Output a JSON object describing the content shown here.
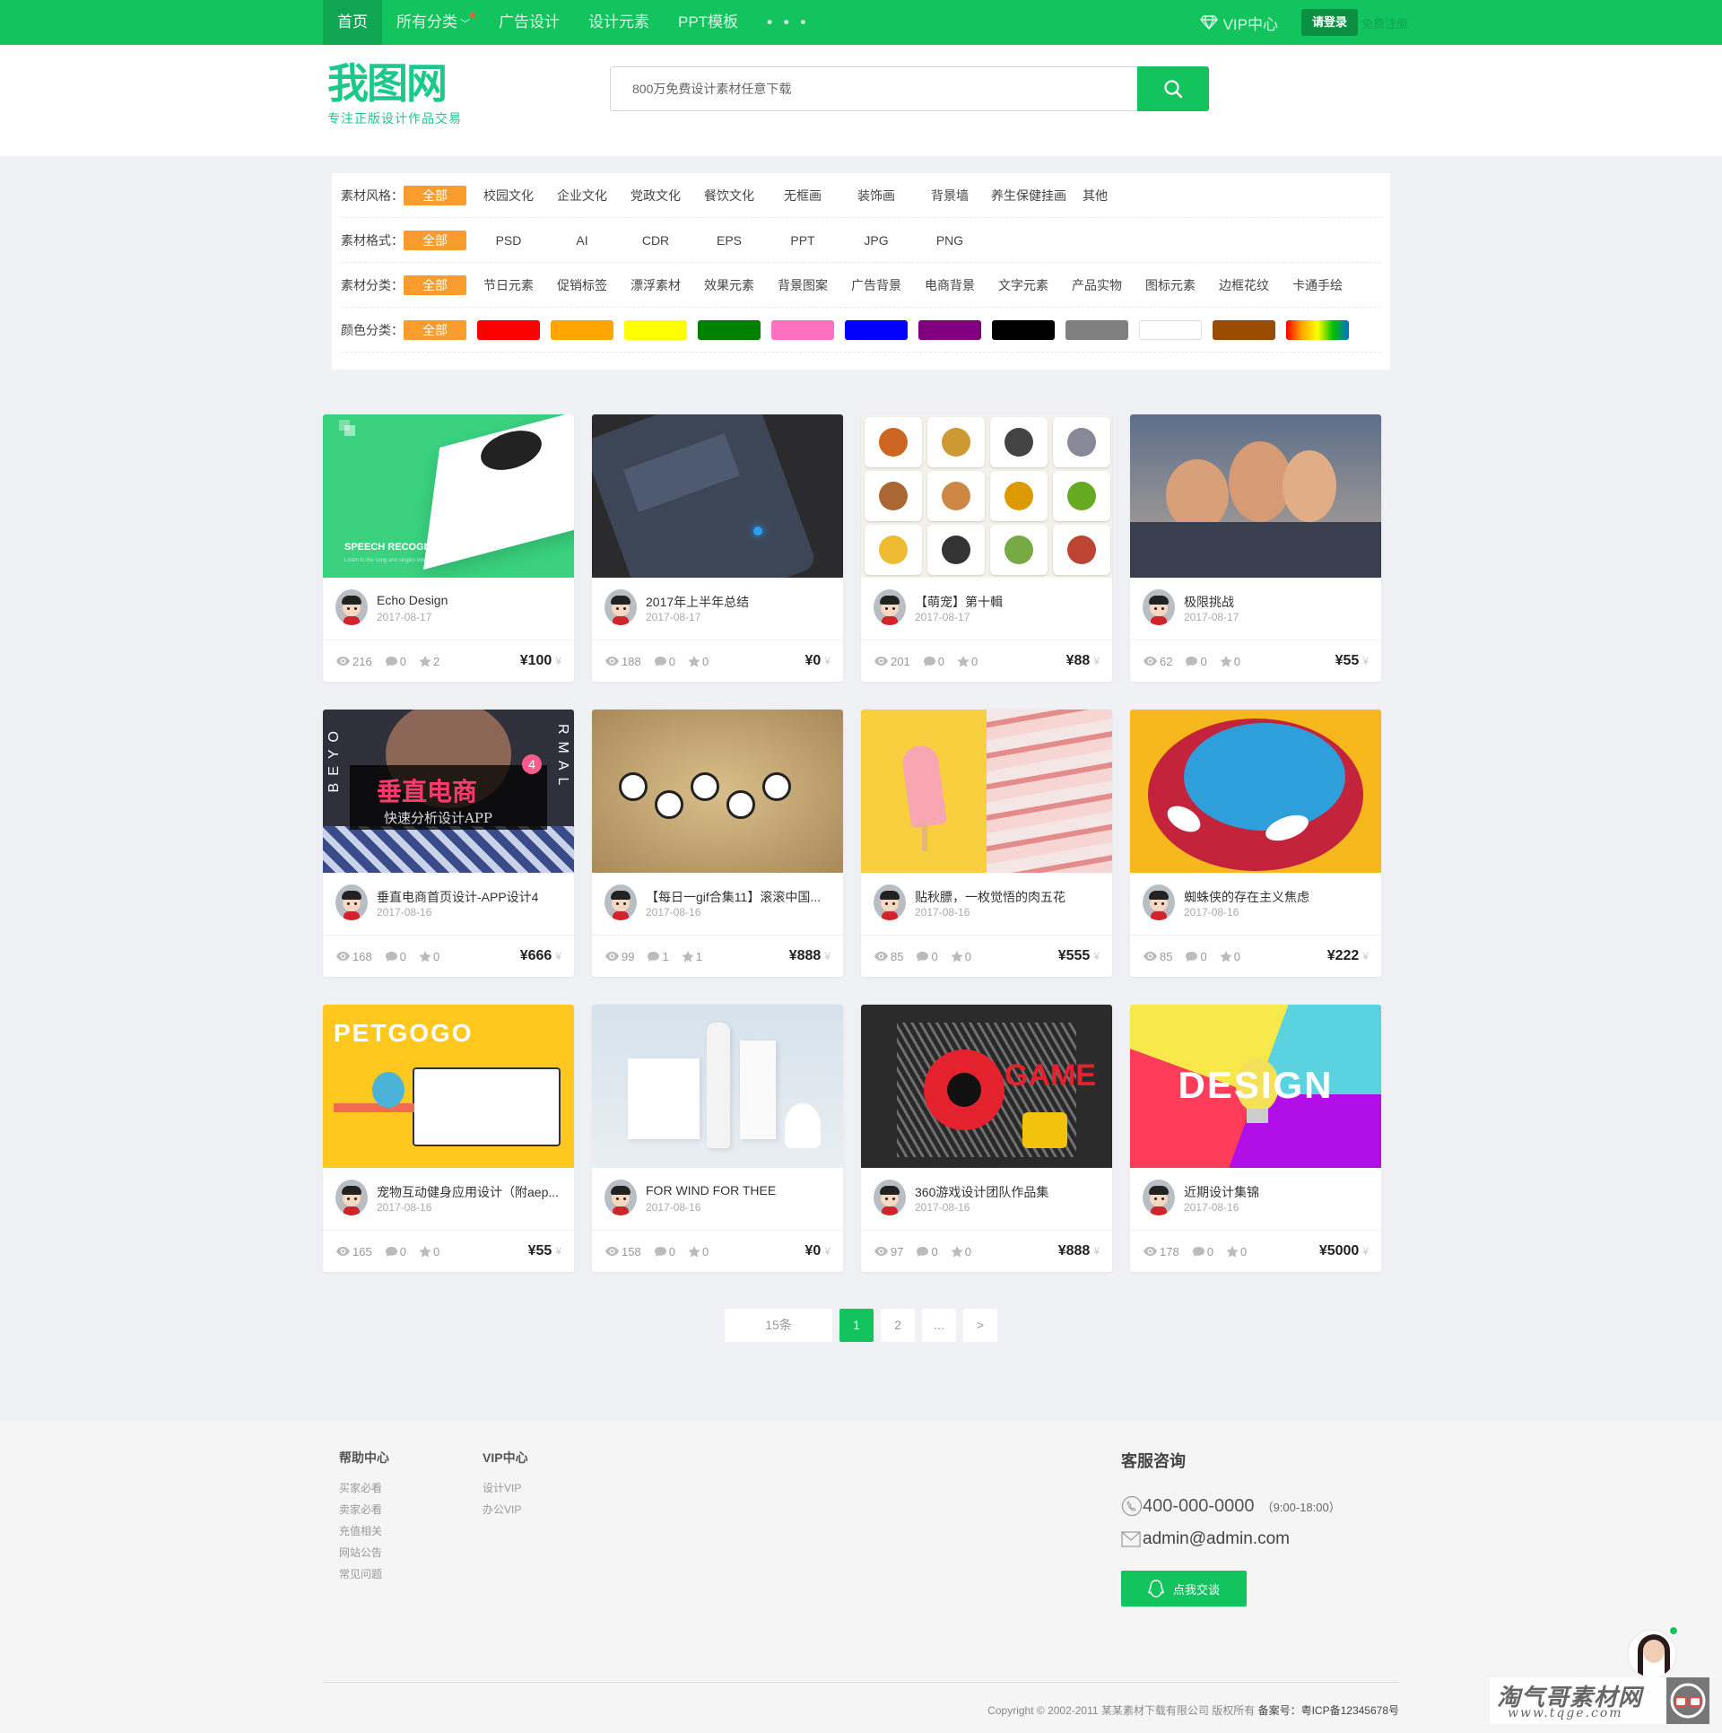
{
  "topnav": {
    "items": [
      {
        "label": "首页",
        "active": true
      },
      {
        "label": "所有分类",
        "has_dropdown": true,
        "has_dot": true
      },
      {
        "label": "广告设计"
      },
      {
        "label": "设计元素"
      },
      {
        "label": "PPT模板"
      },
      {
        "label": "• • •"
      }
    ],
    "vip_label": "VIP中心",
    "login_label": "请登录",
    "register_label": "免费注册"
  },
  "header": {
    "logo_text": "我图网",
    "logo_slogan": "专注正版设计作品交易",
    "search_placeholder": "800万免费设计素材任意下载",
    "search_icon": "search-icon"
  },
  "filters": [
    {
      "label": "素材风格：",
      "options": [
        "全部",
        "校园文化",
        "企业文化",
        "党政文化",
        "餐饮文化",
        "无框画",
        "装饰画",
        "背景墙",
        "养生保健挂画",
        "其他"
      ],
      "active": 0
    },
    {
      "label": "素材格式：",
      "options": [
        "全部",
        "PSD",
        "AI",
        "CDR",
        "EPS",
        "PPT",
        "JPG",
        "PNG"
      ],
      "active": 0
    },
    {
      "label": "素材分类：",
      "options": [
        "全部",
        "节日元素",
        "促销标签",
        "漂浮素材",
        "效果元素",
        "背景图案",
        "广告背景",
        "电商背景",
        "文字元素",
        "产品实物",
        "图标元素",
        "边框花纹",
        "卡通手绘"
      ],
      "active": 0
    },
    {
      "label": "颜色分类：",
      "all_label": "全部",
      "colors": [
        "#ff0000",
        "#ffa500",
        "#ffff00",
        "#008000",
        "#ff70c0",
        "#0000ff",
        "#800080",
        "#000000",
        "#808080",
        "#ffffff",
        "#994c00",
        "rainbow"
      ]
    }
  ],
  "cards": [
    {
      "title": "Echo Design",
      "date": "2017-08-17",
      "views": "216",
      "comments": "0",
      "stars": "2",
      "price": "¥100"
    },
    {
      "title": "2017年上半年总结",
      "date": "2017-08-17",
      "views": "188",
      "comments": "0",
      "stars": "0",
      "price": "¥0"
    },
    {
      "title": "【萌宠】第十輯",
      "date": "2017-08-17",
      "views": "201",
      "comments": "0",
      "stars": "0",
      "price": "¥88"
    },
    {
      "title": "极限挑战",
      "date": "2017-08-17",
      "views": "62",
      "comments": "0",
      "stars": "0",
      "price": "¥55"
    },
    {
      "title": "垂直电商首页设计-APP设计4",
      "date": "2017-08-16",
      "views": "168",
      "comments": "0",
      "stars": "0",
      "price": "¥666"
    },
    {
      "title": "【每日一gif合集11】滚滚中国...",
      "date": "2017-08-16",
      "views": "99",
      "comments": "1",
      "stars": "1",
      "price": "¥888"
    },
    {
      "title": "贴秋膘，一枚觉悟的肉五花",
      "date": "2017-08-16",
      "views": "85",
      "comments": "0",
      "stars": "0",
      "price": "¥555"
    },
    {
      "title": "蜘蛛侠的存在主义焦虑",
      "date": "2017-08-16",
      "views": "85",
      "comments": "0",
      "stars": "0",
      "price": "¥222"
    },
    {
      "title": "宠物互动健身应用设计（附aep...",
      "date": "2017-08-16",
      "views": "165",
      "comments": "0",
      "stars": "0",
      "price": "¥55"
    },
    {
      "title": "FOR WIND FOR THEE",
      "date": "2017-08-16",
      "views": "158",
      "comments": "0",
      "stars": "0",
      "price": "¥0"
    },
    {
      "title": "360游戏设计团队作品集",
      "date": "2017-08-16",
      "views": "97",
      "comments": "0",
      "stars": "0",
      "price": "¥888"
    },
    {
      "title": "近期设计集锦",
      "date": "2017-08-16",
      "views": "178",
      "comments": "0",
      "stars": "0",
      "price": "¥5000"
    }
  ],
  "thumb_texts": {
    "speech": "SPEECH RECOGNITION",
    "speech_sub": "Listen to the song and singles interactive jitter",
    "ecommerce": "垂直电商",
    "ecommerce_sub": "快速分析设计APP",
    "ecommerce_badge": "4",
    "side_left": "BEYO",
    "side_right": "RMAL",
    "petgogo": "PETGOGO",
    "design": "DESIGN",
    "game": "GAME"
  },
  "pagination": {
    "total": "15条",
    "pages": [
      "1",
      "2",
      "...",
      ">"
    ],
    "active": "1"
  },
  "footer": {
    "columns": [
      {
        "title": "帮助中心",
        "links": [
          "买家必看",
          "卖家必看",
          "充值相关",
          "网站公告",
          "常见问题"
        ]
      },
      {
        "title": "VIP中心",
        "links": [
          "设计VIP",
          "办公VIP"
        ]
      }
    ],
    "contact": {
      "title": "客服咨询",
      "phone": "400-000-0000",
      "hours": "（9:00-18:00）",
      "email": "admin@admin.com",
      "chat_label": "点我交谈"
    },
    "copyright": "Copyright © 2002-2011 某某素材下载有限公司 版权所有",
    "icp_label": "备案号：粤ICP备12345678号"
  },
  "watermark": {
    "title": "淘气哥素材网",
    "url": "www.tqge.com"
  },
  "colors": {
    "brand_green": "#13c35e",
    "active_orange": "#f89c2d",
    "logo_teal": "#1dc98a"
  }
}
